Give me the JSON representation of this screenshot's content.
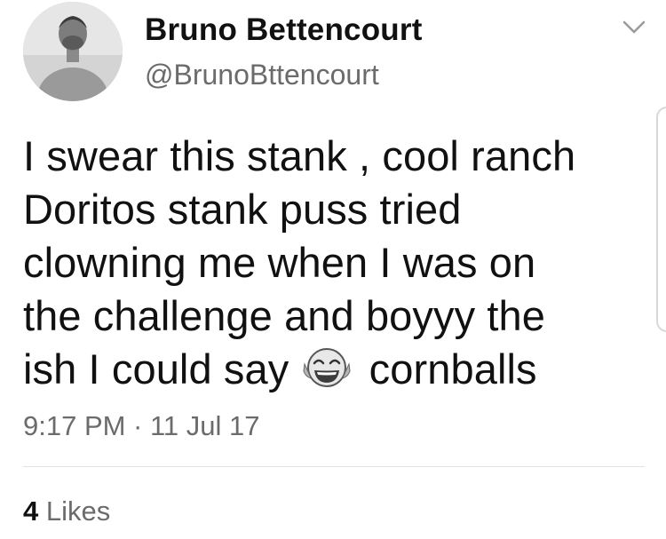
{
  "author": {
    "display_name": "Bruno Bettencourt",
    "handle": "@BrunoBttencourt",
    "avatar_icon": "profile-photo"
  },
  "menu": {
    "icon": "chevron-down-icon"
  },
  "tweet": {
    "lines": [
      "I swear this stank , cool ranch",
      "Doritos stank puss tried",
      "clowning me when I was on",
      "the challenge and boyyy the"
    ],
    "last_line_before_emoji": "ish I could say",
    "emoji": "face-with-tears-of-joy",
    "last_line_after_emoji": "cornballs"
  },
  "timestamp": "9:17 PM · 11 Jul 17",
  "stats": {
    "likes_count": "4",
    "likes_label": "Likes"
  }
}
